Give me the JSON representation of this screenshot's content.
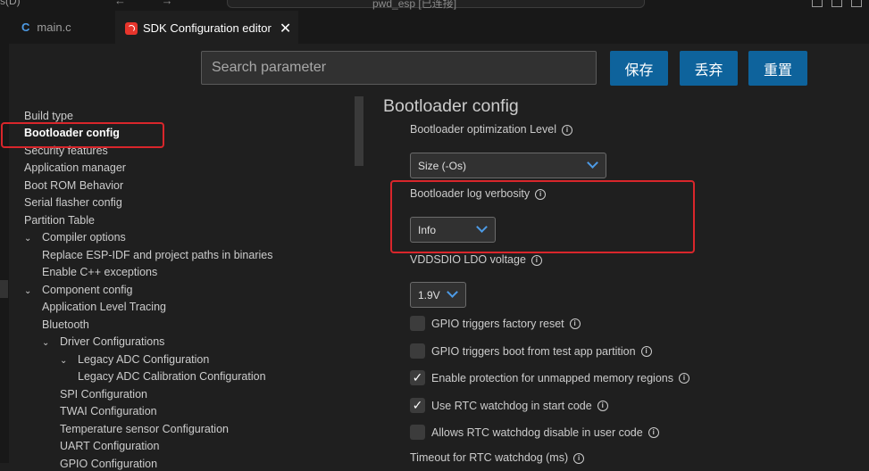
{
  "titlebar": {
    "left_text": "s(D)",
    "arrows": "← →",
    "command_text": "pwd_esp [已连接]"
  },
  "tabs": [
    {
      "icon": "C",
      "label": "main.c"
    },
    {
      "label": "SDK Configuration editor",
      "close": "✕"
    }
  ],
  "search": {
    "placeholder": "Search parameter"
  },
  "buttons": {
    "save": "保存",
    "discard": "丢弃",
    "reset": "重置"
  },
  "sidebar": {
    "items": [
      {
        "label": "Build type"
      },
      {
        "label": "Bootloader config"
      },
      {
        "label": "Security features"
      },
      {
        "label": "Application manager"
      },
      {
        "label": "Boot ROM Behavior"
      },
      {
        "label": "Serial flasher config"
      },
      {
        "label": "Partition Table"
      },
      {
        "label": "Compiler options"
      },
      {
        "label": "Replace ESP-IDF and project paths in binaries"
      },
      {
        "label": "Enable C++ exceptions"
      },
      {
        "label": "Component config"
      },
      {
        "label": "Application Level Tracing"
      },
      {
        "label": "Bluetooth"
      },
      {
        "label": "Driver Configurations"
      },
      {
        "label": "Legacy ADC Configuration"
      },
      {
        "label": "Legacy ADC Calibration Configuration"
      },
      {
        "label": "SPI Configuration"
      },
      {
        "label": "TWAI Configuration"
      },
      {
        "label": "Temperature sensor Configuration"
      },
      {
        "label": "UART Configuration"
      },
      {
        "label": "GPIO Configuration"
      }
    ]
  },
  "main": {
    "section_title": "Bootloader config",
    "opt_level": {
      "label": "Bootloader optimization Level",
      "value": "Size (-Os)"
    },
    "log_verbosity": {
      "label": "Bootloader log verbosity",
      "value": "Info"
    },
    "vddsdio": {
      "label": "VDDSDIO LDO voltage",
      "value": "1.9V"
    },
    "checkboxes": [
      {
        "label": "GPIO triggers factory reset",
        "checked": false
      },
      {
        "label": "GPIO triggers boot from test app partition",
        "checked": false
      },
      {
        "label": "Enable protection for unmapped memory regions",
        "checked": true
      },
      {
        "label": "Use RTC watchdog in start code",
        "checked": true
      },
      {
        "label": "Allows RTC watchdog disable in user code",
        "checked": false
      }
    ],
    "timeout_label": "Timeout for RTC watchdog (ms)",
    "check_glyph": "✓",
    "info_glyph": "i"
  },
  "colors": {
    "accent_button": "#0e639c",
    "highlight_box": "#d9262b",
    "background": "#1f1f1f"
  }
}
